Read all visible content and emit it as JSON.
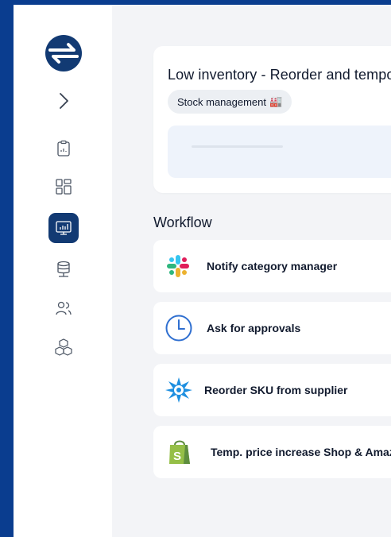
{
  "sidebar": {
    "logo": "brand-logo",
    "expand_icon": "chevron-right-icon",
    "items": [
      {
        "icon": "clipboard-icon"
      },
      {
        "icon": "dashboard-grid-icon"
      },
      {
        "icon": "monitor-chart-icon",
        "active": true
      },
      {
        "icon": "database-icon"
      },
      {
        "icon": "users-icon"
      },
      {
        "icon": "cubes-icon"
      }
    ]
  },
  "card": {
    "title": "Low inventory - Reorder and temporarily increase price",
    "tag": {
      "label": "Stock management",
      "emoji": "🏭"
    }
  },
  "workflow": {
    "heading": "Workflow",
    "steps": [
      {
        "label": "Notify category manager",
        "icon": "slack-icon"
      },
      {
        "label": "Ask for approvals",
        "icon": "clock-icon"
      },
      {
        "label": "Reorder SKU from supplier",
        "icon": "starburst-icon"
      },
      {
        "label": "Temp. price increase Shop & Amazon",
        "icon": "shopify-bag-icon"
      }
    ]
  },
  "colors": {
    "frame_border": "#0a3d8f",
    "sidebar_active": "#123a73",
    "text": "#111a2e",
    "page_bg": "#f3f4f7"
  }
}
